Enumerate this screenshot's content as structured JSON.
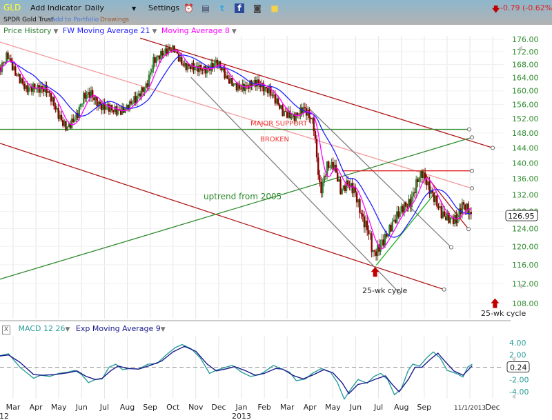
{
  "toolbar": {
    "symbol": "GLD",
    "add_indicator": "Add Indicator",
    "interval": "Daily",
    "interval_caret": "▼",
    "settings": "Settings",
    "icons": [
      "alarm-clock-icon",
      "database-icon",
      "twitter-icon",
      "facebook-icon",
      "camera-icon",
      "sticky-note-icon"
    ],
    "change": "-0.79 (-0.62%)",
    "change_arrow": "down-arrow-icon",
    "name": "SPDR Gold Trust",
    "add_to_portfolio": "Add to Portfolio",
    "drawings": "Drawings"
  },
  "legend": {
    "price_history": "Price History",
    "ma21": "FW Moving Average 21",
    "ma8": "Moving Average 8",
    "caret": "▼"
  },
  "colors": {
    "up": "#2e7d32",
    "down": "#8b0000",
    "ma21": "#1f1fff",
    "ma8": "#ff00ff",
    "axis_text": "#2e8b2e",
    "macd": "#2a9d99",
    "signal": "#1a1a8c",
    "change": "#e02020"
  },
  "macd_header": {
    "close": "X",
    "macd": "MACD 12 26",
    "signal": "Exp Moving Average 9",
    "caret": "▼"
  },
  "annotations": {
    "major_support": "MAJOR SUPPORT",
    "broken": "BROKEN",
    "uptrend": "uptrend from 2005",
    "cycle1": "25-wk cycle",
    "cycle2": "25-wk cycle"
  },
  "chart_data": [
    {
      "type": "candlestick",
      "title": "GLD Daily",
      "scale": "log",
      "ylim": [
        106,
        178
      ],
      "y_ticks": [
        "176.00",
        "172.00",
        "168.00",
        "164.00",
        "160.00",
        "156.00",
        "152.00",
        "148.00",
        "144.00",
        "140.00",
        "136.00",
        "132.00",
        "128.00",
        "124.00",
        "120.00",
        "116.00",
        "112.00",
        "108.00"
      ],
      "last_price": "126.95",
      "x_ticks": [
        "Mar",
        "Apr",
        "May",
        "Jun",
        "Jul",
        "Aug",
        "Sep",
        "Oct",
        "Nov",
        "Dec",
        "Jan",
        "Feb",
        "Mar",
        "Apr",
        "May",
        "Jun",
        "Jul",
        "Aug",
        "Sep",
        "11/1/2013",
        "Dec"
      ],
      "x_tick_months": [
        0,
        1,
        2,
        3,
        4,
        5,
        6,
        7,
        8,
        9,
        10,
        11,
        12,
        13,
        14,
        15,
        16,
        17,
        18,
        20,
        21
      ],
      "year_labels": [
        {
          "t": -0.45,
          "label": "12"
        },
        {
          "t": 10,
          "label": "2013"
        }
      ],
      "x_unit": "months since Mar 2012",
      "price_path": [
        [
          -0.55,
          167
        ],
        [
          -0.25,
          172
        ],
        [
          0.1,
          165
        ],
        [
          0.55,
          160
        ],
        [
          0.95,
          162
        ],
        [
          1.45,
          160
        ],
        [
          1.9,
          154
        ],
        [
          2.35,
          150
        ],
        [
          2.8,
          152
        ],
        [
          3.1,
          158
        ],
        [
          3.4,
          160
        ],
        [
          3.9,
          155
        ],
        [
          4.35,
          154
        ],
        [
          4.8,
          155
        ],
        [
          5.4,
          157
        ],
        [
          5.85,
          162
        ],
        [
          6.15,
          170
        ],
        [
          6.6,
          171
        ],
        [
          7.05,
          173
        ],
        [
          7.5,
          168
        ],
        [
          8.0,
          166
        ],
        [
          8.45,
          167
        ],
        [
          8.9,
          169
        ],
        [
          9.35,
          163
        ],
        [
          9.8,
          162
        ],
        [
          10.25,
          161
        ],
        [
          10.7,
          162
        ],
        [
          11.2,
          161
        ],
        [
          11.5,
          157
        ],
        [
          11.8,
          153
        ],
        [
          12.25,
          153
        ],
        [
          12.7,
          155
        ],
        [
          13.15,
          150
        ],
        [
          13.3,
          141
        ],
        [
          13.45,
          133
        ],
        [
          13.75,
          140
        ],
        [
          14.05,
          139
        ],
        [
          14.35,
          132
        ],
        [
          14.65,
          135
        ],
        [
          14.95,
          134
        ],
        [
          15.3,
          126
        ],
        [
          15.6,
          122
        ],
        [
          15.75,
          118
        ],
        [
          15.9,
          119
        ],
        [
          16.2,
          122
        ],
        [
          16.5,
          124
        ],
        [
          16.8,
          126
        ],
        [
          17.1,
          129
        ],
        [
          17.4,
          131
        ],
        [
          17.7,
          136
        ],
        [
          17.9,
          137
        ],
        [
          18.2,
          133
        ],
        [
          18.5,
          131
        ],
        [
          18.8,
          128
        ],
        [
          19.1,
          126
        ],
        [
          19.4,
          125
        ],
        [
          19.7,
          130
        ],
        [
          19.95,
          129
        ],
        [
          20.1,
          126.95
        ]
      ],
      "trendlines": [
        {
          "name": "major-downtrend-upper",
          "color": "#b01818",
          "p1": [
            5.56,
            176.4
          ],
          "p2": [
            21.0,
            144.0
          ],
          "end_marker": true
        },
        {
          "name": "major-downtrend-lower",
          "color": "#b01818",
          "p1": [
            -0.67,
            145.4
          ],
          "p2": [
            18.87,
            110.8
          ],
          "end_marker": true
        },
        {
          "name": "pink-downtrend",
          "color": "#f49a9a",
          "p1": [
            -0.67,
            175.3
          ],
          "p2": [
            20.09,
            133.6
          ],
          "end_marker": true
        },
        {
          "name": "major-support",
          "color": "#2e8b2e",
          "p1": [
            -0.67,
            149.0
          ],
          "p2": [
            19.97,
            149.0
          ],
          "end_marker": true
        },
        {
          "name": "uptrend-2005",
          "color": "#2e8b2e",
          "p1": [
            -0.67,
            112.8
          ],
          "p2": [
            20.09,
            146.8
          ],
          "end_marker": true
        },
        {
          "name": "gray-channel-1",
          "color": "#808080",
          "p1": [
            7.78,
            164.1
          ],
          "p2": [
            16.9,
            110.2
          ],
          "end_marker": true
        },
        {
          "name": "gray-channel-2",
          "color": "#808080",
          "p1": [
            12.95,
            154.9
          ],
          "p2": [
            19.18,
            119.8
          ],
          "end_marker": true
        },
        {
          "name": "resistance-138",
          "color": "#e02020",
          "p1": [
            14.4,
            138.0
          ],
          "p2": [
            20.09,
            138.0
          ],
          "end_marker": true
        },
        {
          "name": "short-uptrend",
          "color": "#22b022",
          "p1": [
            15.9,
            115.9
          ],
          "p2": [
            18.54,
            132.9
          ],
          "end_marker": false
        },
        {
          "name": "short-downtrend",
          "color": "#b01818",
          "p1": [
            17.93,
            137.9
          ],
          "p2": [
            19.94,
            123.9
          ],
          "end_marker": true
        }
      ],
      "cycle_markers": [
        {
          "t": 15.85,
          "price": 115.5
        },
        {
          "t": 21.1,
          "price": 109
        }
      ]
    },
    {
      "type": "line",
      "title": "MACD 12 26 / Exp Moving Average 9",
      "ylim": [
        -5.5,
        4.8
      ],
      "y_ticks": [
        "4.00",
        "2.00",
        "-2.00",
        "-4.00"
      ],
      "y_tick_values": [
        4,
        2,
        -2,
        -4
      ],
      "last_value": "0.24",
      "series": [
        {
          "name": "MACD 12 26",
          "points": [
            [
              -0.67,
              1.8
            ],
            [
              -0.2,
              2.2
            ],
            [
              0.3,
              0
            ],
            [
              0.9,
              -1.8
            ],
            [
              1.2,
              -1.3
            ],
            [
              1.6,
              -1.5
            ],
            [
              2,
              -1
            ],
            [
              2.4,
              -0.8
            ],
            [
              2.7,
              -0.5
            ],
            [
              3.0,
              -1.2
            ],
            [
              3.3,
              -2.5
            ],
            [
              3.6,
              -2
            ],
            [
              3.9,
              -1.9
            ],
            [
              4.2,
              0
            ],
            [
              4.5,
              0.5
            ],
            [
              4.8,
              -0.4
            ],
            [
              5.1,
              -0.2
            ],
            [
              5.5,
              -0.3
            ],
            [
              5.9,
              0.5
            ],
            [
              6.3,
              0.6
            ],
            [
              6.7,
              2
            ],
            [
              7.1,
              3.2
            ],
            [
              7.4,
              3.7
            ],
            [
              7.8,
              3
            ],
            [
              8.2,
              1.5
            ],
            [
              8.6,
              -1
            ],
            [
              8.9,
              -0.5
            ],
            [
              9.3,
              0
            ],
            [
              9.6,
              0.3
            ],
            [
              10,
              -0.8
            ],
            [
              10.4,
              -1.5
            ],
            [
              10.8,
              -1.2
            ],
            [
              11.1,
              -0.5
            ],
            [
              11.4,
              0.3
            ],
            [
              11.7,
              -0.2
            ],
            [
              12.1,
              -0.8
            ],
            [
              12.4,
              -2.2
            ],
            [
              12.8,
              -1.9
            ],
            [
              13.1,
              -1
            ],
            [
              13.5,
              -0.2
            ],
            [
              13.9,
              -0.8
            ],
            [
              14.2,
              -2.5
            ],
            [
              14.5,
              -5.2
            ],
            [
              14.8,
              -3.5
            ],
            [
              15.1,
              -2
            ],
            [
              15.5,
              -2.6
            ],
            [
              15.8,
              -1.5
            ],
            [
              16.1,
              -1
            ],
            [
              16.4,
              -2
            ],
            [
              16.7,
              -4.5
            ],
            [
              17.0,
              -3.5
            ],
            [
              17.3,
              -0.5
            ],
            [
              17.5,
              0.5
            ],
            [
              17.8,
              0.2
            ],
            [
              18.1,
              1.5
            ],
            [
              18.4,
              2.5
            ],
            [
              18.7,
              1.5
            ],
            [
              19.0,
              -0.5
            ],
            [
              19.4,
              -1
            ],
            [
              19.7,
              -1.6
            ],
            [
              19.9,
              0
            ],
            [
              20.1,
              0.5
            ]
          ]
        },
        {
          "name": "Exp Moving Average 9",
          "points": [
            [
              -0.67,
              1.8
            ],
            [
              -0.2,
              2.0
            ],
            [
              0.3,
              0.8
            ],
            [
              0.9,
              -1.2
            ],
            [
              1.3,
              -1.3
            ],
            [
              1.8,
              -1.2
            ],
            [
              2.4,
              -0.9
            ],
            [
              2.8,
              -0.6
            ],
            [
              3.2,
              -1.5
            ],
            [
              3.6,
              -2.0
            ],
            [
              3.9,
              -1.8
            ],
            [
              4.3,
              -0.5
            ],
            [
              4.6,
              0.2
            ],
            [
              5.0,
              -0.2
            ],
            [
              5.5,
              -0.3
            ],
            [
              6.0,
              0.3
            ],
            [
              6.5,
              1.0
            ],
            [
              7.0,
              2.5
            ],
            [
              7.5,
              3.4
            ],
            [
              8.0,
              2.6
            ],
            [
              8.5,
              0.5
            ],
            [
              8.9,
              -0.6
            ],
            [
              9.4,
              -0.2
            ],
            [
              9.7,
              0.1
            ],
            [
              10.2,
              -0.6
            ],
            [
              10.6,
              -1.3
            ],
            [
              11.0,
              -1.0
            ],
            [
              11.5,
              -0.2
            ],
            [
              11.8,
              -0.3
            ],
            [
              12.3,
              -1.4
            ],
            [
              12.7,
              -1.9
            ],
            [
              13.1,
              -1.3
            ],
            [
              13.6,
              -0.4
            ],
            [
              14.0,
              -0.9
            ],
            [
              14.4,
              -2.5
            ],
            [
              14.7,
              -4.3
            ],
            [
              15.1,
              -2.8
            ],
            [
              15.5,
              -2.5
            ],
            [
              15.9,
              -1.9
            ],
            [
              16.3,
              -1.4
            ],
            [
              16.6,
              -2.8
            ],
            [
              16.9,
              -4.0
            ],
            [
              17.3,
              -2.0
            ],
            [
              17.6,
              0
            ],
            [
              17.9,
              0
            ],
            [
              18.3,
              1.4
            ],
            [
              18.6,
              2.3
            ],
            [
              18.9,
              1.0
            ],
            [
              19.3,
              -0.6
            ],
            [
              19.7,
              -1.3
            ],
            [
              20.1,
              0.24
            ]
          ]
        }
      ]
    }
  ]
}
